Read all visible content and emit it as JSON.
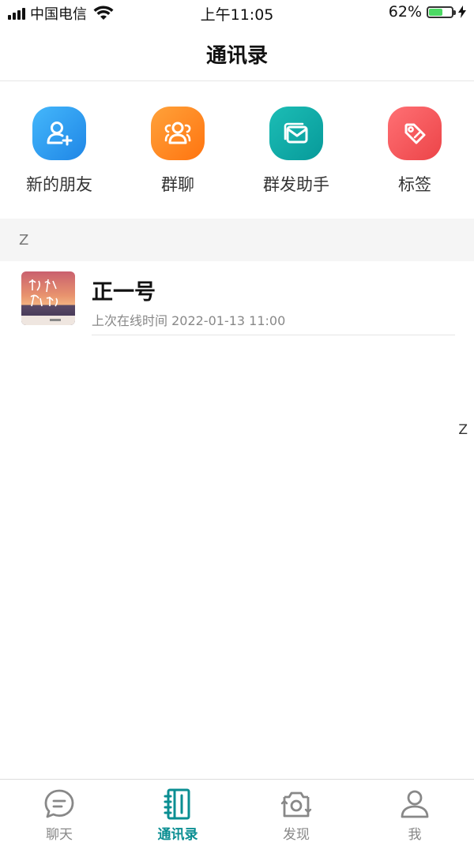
{
  "status_bar": {
    "carrier": "中国电信",
    "time": "上午11:05",
    "battery_percent_text": "62%",
    "battery_level": 0.62,
    "signal_bars": 4,
    "icons": [
      "signal-icon",
      "wifi-icon",
      "battery-icon",
      "charging-icon"
    ]
  },
  "header": {
    "title": "通讯录"
  },
  "shortcuts": [
    {
      "label": "新的朋友",
      "icon": "add-friend-icon",
      "color": "#2e9cf0"
    },
    {
      "label": "群聊",
      "icon": "group-chat-icon",
      "color": "#ff8a1c"
    },
    {
      "label": "群发助手",
      "icon": "broadcast-mail-icon",
      "color": "#0fa8a4"
    },
    {
      "label": "标签",
      "icon": "tag-icon",
      "color": "#f45a5e"
    }
  ],
  "section": {
    "letter": "Z"
  },
  "contacts": [
    {
      "name": "正一号",
      "status": "上次在线时间 2022-01-13 11:00",
      "avatar": "album-cover-avatar"
    }
  ],
  "index_bar": {
    "letters": [
      "Z"
    ]
  },
  "tab_bar": {
    "tabs": [
      {
        "label": "聊天",
        "icon": "chat-icon",
        "active": false
      },
      {
        "label": "通讯录",
        "icon": "contacts-icon",
        "active": true
      },
      {
        "label": "发现",
        "icon": "discover-icon",
        "active": false
      },
      {
        "label": "我",
        "icon": "profile-icon",
        "active": false
      }
    ]
  },
  "colors": {
    "accent": "#0a8e92",
    "inactive_tab": "#888888",
    "section_bg": "#f5f5f5"
  }
}
